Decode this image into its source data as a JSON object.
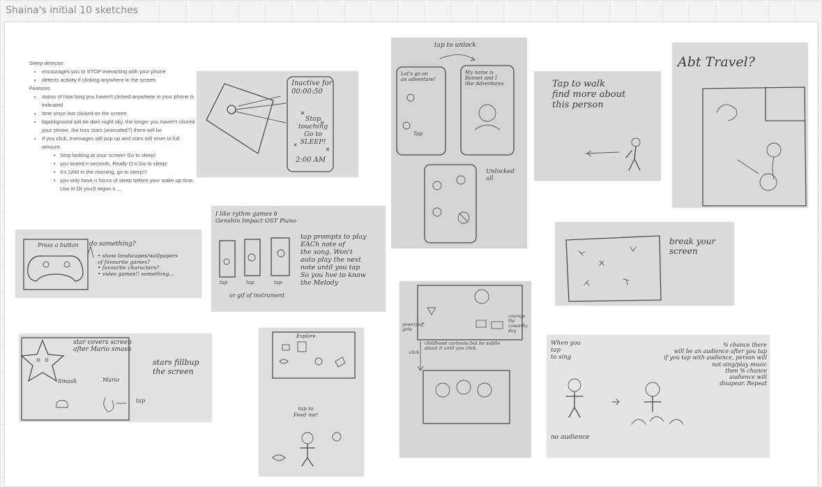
{
  "board": {
    "title": "Shaina's initial 10 sketches"
  },
  "notes": {
    "heading": "Sleep detector",
    "bullets1": [
      "encourages you to STOP interacting with your phone",
      "detects activity if clicking anywhere in the screen"
    ],
    "features_label": "Features",
    "features": [
      "status of how long you haven't clicked anywhere in your phone is indicated",
      "time since last clicked on the screen",
      "bgackground will be dark night sky, the longer you haven't clicked your phone, the less stars (animated?) there will be",
      "If you click, messages will pop up and stars will reset to full amount."
    ],
    "messages": [
      "Stop looking at your screen! Go to sleep!",
      "you lasted n seconds. Really O.o Go to sleep!",
      "It's 2AM in the morning, go to sleep!!!",
      "you only have n hours of sleep before your wake up time. Use it! Or you'll regret it...."
    ]
  },
  "sketches": {
    "inactive": {
      "header": "Inactive for",
      "timer": "00:00:50",
      "message": "Stop touching\nGo to\nSLEEP!",
      "clock": "2:00 AM"
    },
    "unlock": {
      "caption": "tap to unlock",
      "screen1": "Let's go on\nan adventure!",
      "screen2": "My name is\nBonnet and I\nlike Adventures",
      "tap": "Tap",
      "unlocked": "Unlocked\nall"
    },
    "walk": {
      "text": "Tap to walk\nfind more about\nthis person"
    },
    "travel": {
      "title": "Abt Travel?"
    },
    "controller": {
      "press": "Press a button",
      "do": "do something?",
      "options": "• show landscapes/wallpapers\n  of favourite games?\n• favourite characters?\n• video games!! something..."
    },
    "rhythm": {
      "title": "I like rythm games 8\nGenshin Impact OST  Piano",
      "desc": "tap prompts to play\nEACh note of\nthe song. Won't\nauto play the next\nnote until you tap\nSo you hve to know\nthe Melody",
      "taps": [
        "tap",
        "tap",
        "tap"
      ],
      "foot": "or gif of instrument"
    },
    "breakscreen": {
      "text": "break your\nscreen"
    },
    "star": {
      "caption": "star covers screen\nafter Mario smash",
      "fill": "stars fillbup\nthe screen",
      "smash": "Smash",
      "mario": "Mario",
      "tap": "tap"
    },
    "explore": {
      "tab": "Explore",
      "feed": "tap to\nFeed me!"
    },
    "cartoons": {
      "caption": "childhood cartoons but be subtle\nabout it until you click",
      "left": "powerpuff\ngirls",
      "right": "courage the\ncowardly\ndog",
      "click": "click"
    },
    "audience": {
      "when": "When you\ntap\nto sing",
      "chance": "% chance there\nwill be an audience after you tap\nif you tap with audience, person will\nnot sing/play music\nthen % chance\naudience will\ndisapear. Repeat",
      "no": "no audience"
    }
  }
}
